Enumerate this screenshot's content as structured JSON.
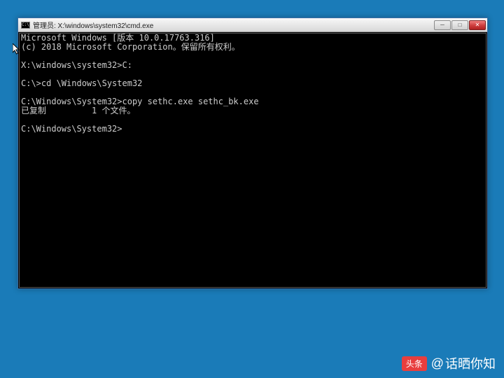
{
  "window": {
    "icon_label": "C:\\",
    "title": "管理员: X:\\windows\\system32\\cmd.exe"
  },
  "buttons": {
    "minimize": "─",
    "maximize": "□",
    "close": "✕"
  },
  "console": {
    "lines": [
      "Microsoft Windows [版本 10.0.17763.316]",
      "(c) 2018 Microsoft Corporation。保留所有权利。",
      "",
      "X:\\windows\\system32>C:",
      "",
      "C:\\>cd \\Windows\\System32",
      "",
      "C:\\Windows\\System32>copy sethc.exe sethc_bk.exe",
      "已复制         1 个文件。",
      "",
      "C:\\Windows\\System32>"
    ]
  },
  "watermark": {
    "badge": "头条",
    "at": "@",
    "name": "话晒你知"
  }
}
